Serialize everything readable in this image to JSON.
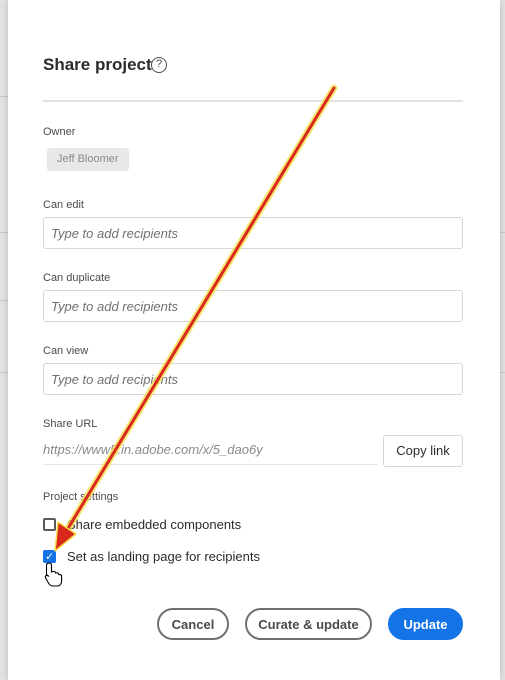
{
  "dialog": {
    "title": "Share project",
    "help_icon": "?"
  },
  "owner": {
    "label": "Owner",
    "name": "Jeff Bloomer"
  },
  "can_edit": {
    "label": "Can edit",
    "placeholder": "Type to add recipients"
  },
  "can_duplicate": {
    "label": "Can duplicate",
    "placeholder": "Type to add recipients"
  },
  "can_view": {
    "label": "Can view",
    "placeholder": "Type to add recipients"
  },
  "share_url": {
    "label": "Share URL",
    "value": "https://www5.in.adobe.com/x/5_dao6y",
    "copy_label": "Copy link"
  },
  "project_settings": {
    "label": "Project settings",
    "options": [
      {
        "label": "Share embedded components",
        "checked": false
      },
      {
        "label": "Set as landing page for recipients",
        "checked": true
      }
    ]
  },
  "footer": {
    "cancel_label": "Cancel",
    "curate_label": "Curate & update",
    "update_label": "Update"
  },
  "colors": {
    "accent": "#1473e6",
    "annotation_arrow": "#d8291b",
    "annotation_glow": "#f5e04a"
  },
  "icons": {
    "help": "help-icon",
    "check": "checkmark-icon",
    "cursor": "hand-pointer-icon",
    "annotation": "red-arrow-annotation"
  }
}
